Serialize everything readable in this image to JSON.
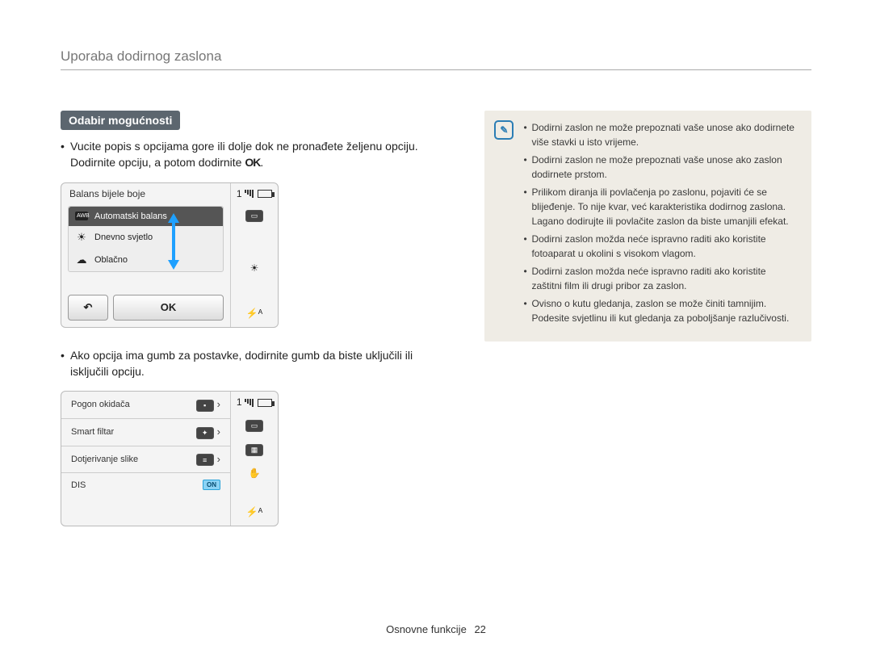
{
  "header": {
    "title": "Uporaba dodirnog zaslona"
  },
  "section": {
    "pill": "Odabir mogućnosti",
    "para1_pre": "Vucite popis s opcijama gore ili dolje dok ne pronađete željenu opciju. Dodirnite opciju, a potom dodirnite ",
    "para1_ok": "OK",
    "para1_post": ".",
    "para2": "Ako opcija ima gumb za postavke, dodirnite gumb da biste uključili ili isključili opciju."
  },
  "mock1": {
    "title": "Balans bijele boje",
    "items": [
      {
        "icon": "AWB",
        "label": "Automatski balans",
        "selected": true
      },
      {
        "icon": "☀",
        "label": "Dnevno svjetlo",
        "selected": false
      },
      {
        "icon": "☁",
        "label": "Oblačno",
        "selected": false
      }
    ],
    "back": "↶",
    "ok": "OK",
    "side": {
      "count": "1",
      "flash": "⚡ᴬ",
      "wb": "☀"
    }
  },
  "mock2": {
    "rows": [
      {
        "label": "Pogon okidača",
        "icon": "single"
      },
      {
        "label": "Smart filtar",
        "icon": "filter"
      },
      {
        "label": "Dotjerivanje slike",
        "icon": "adjust"
      },
      {
        "label": "DIS",
        "toggle": "ON"
      }
    ],
    "side": {
      "count": "1",
      "flash": "⚡ᴬ"
    }
  },
  "info": {
    "items": [
      "Dodirni zaslon ne može prepoznati vaše unose ako dodirnete više stavki u isto vrijeme.",
      "Dodirni zaslon ne može prepoznati vaše unose ako zaslon dodirnete prstom.",
      "Prilikom diranja ili povlačenja po zaslonu, pojaviti će se blijeđenje. To nije kvar, već karakteristika dodirnog zaslona. Lagano dodirujte ili povlačite zaslon da biste umanjili efekat.",
      "Dodirni zaslon možda neće ispravno raditi ako koristite fotoaparat u okolini s visokom vlagom.",
      "Dodirni zaslon možda neće ispravno raditi ako koristite zaštitni film ili drugi pribor za zaslon.",
      "Ovisno o kutu gledanja, zaslon se može činiti tamnijim. Podesite svjetlinu ili kut gledanja za poboljšanje razlučivosti."
    ]
  },
  "footer": {
    "label": "Osnovne funkcije",
    "page": "22"
  }
}
